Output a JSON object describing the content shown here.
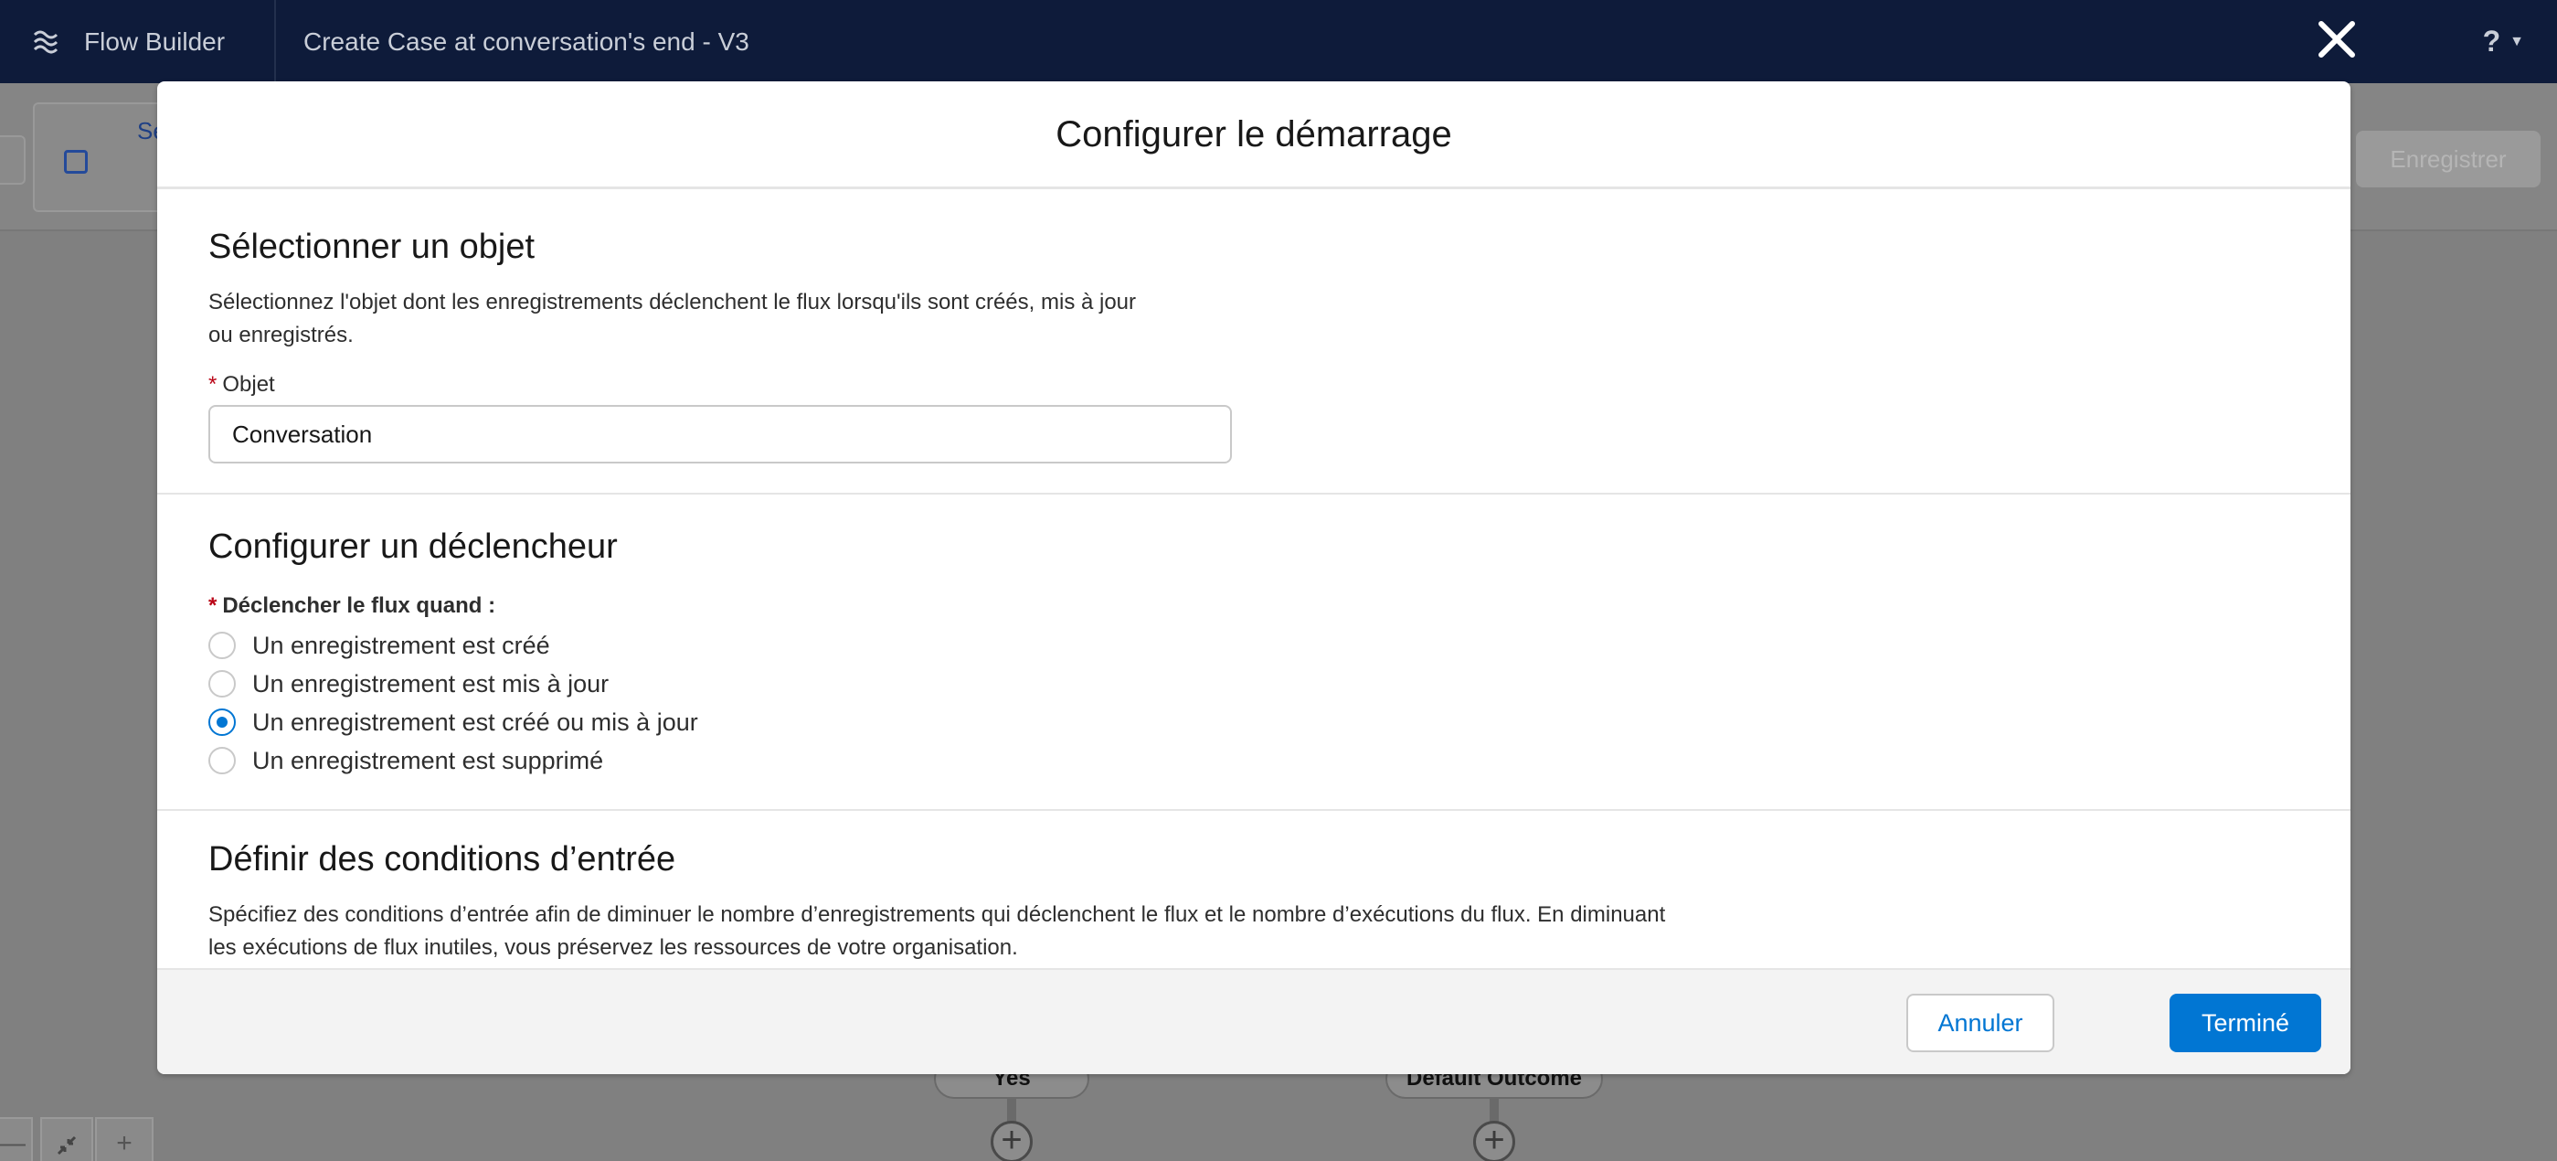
{
  "header": {
    "app_name": "Flow Builder",
    "flow_title": "Create Case at conversation's end - V3",
    "help_label": "?",
    "app_icon": "flow-icon",
    "close_icon": "close-icon"
  },
  "builder": {
    "toolbar_partial_label": "Se",
    "save_label": "Enregistrer",
    "canvas": {
      "outcome_yes": "Yes",
      "outcome_default": "Default Outcome"
    },
    "zoom": {
      "out_label": "—",
      "fit_icon": "fit-view-icon",
      "in_label": "+"
    }
  },
  "modal": {
    "title": "Configurer le démarrage",
    "section_object": {
      "title": "Sélectionner un objet",
      "description_line1": "Sélectionnez l'objet dont les enregistrements déclenchent le flux lorsqu'ils sont créés, mis à jour",
      "description_line2": "ou enregistrés.",
      "required_marker": "*",
      "field_label": "Objet",
      "field_value": "Conversation"
    },
    "section_trigger": {
      "title": "Configurer un déclencheur",
      "required_marker": "*",
      "label": "Déclencher le flux quand :",
      "options": [
        {
          "label": "Un enregistrement est créé",
          "checked": false
        },
        {
          "label": "Un enregistrement est mis à jour",
          "checked": false
        },
        {
          "label": "Un enregistrement est créé ou mis à jour",
          "checked": true
        },
        {
          "label": "Un enregistrement est supprimé",
          "checked": false
        }
      ]
    },
    "section_conditions": {
      "title": "Définir des conditions d’entrée",
      "description_line1": "Spécifiez des conditions d’entrée afin de diminuer le nombre d’enregistrements qui déclenchent le flux et le nombre d’exécutions du flux. En diminuant",
      "description_line2": "les exécutions de flux inutiles, vous préservez les ressources de votre organisation."
    },
    "footer": {
      "cancel_label": "Annuler",
      "done_label": "Terminé"
    }
  },
  "colors": {
    "header_bg": "#0e1b3a",
    "brand_blue": "#0176d3",
    "required_red": "#ba0517"
  }
}
